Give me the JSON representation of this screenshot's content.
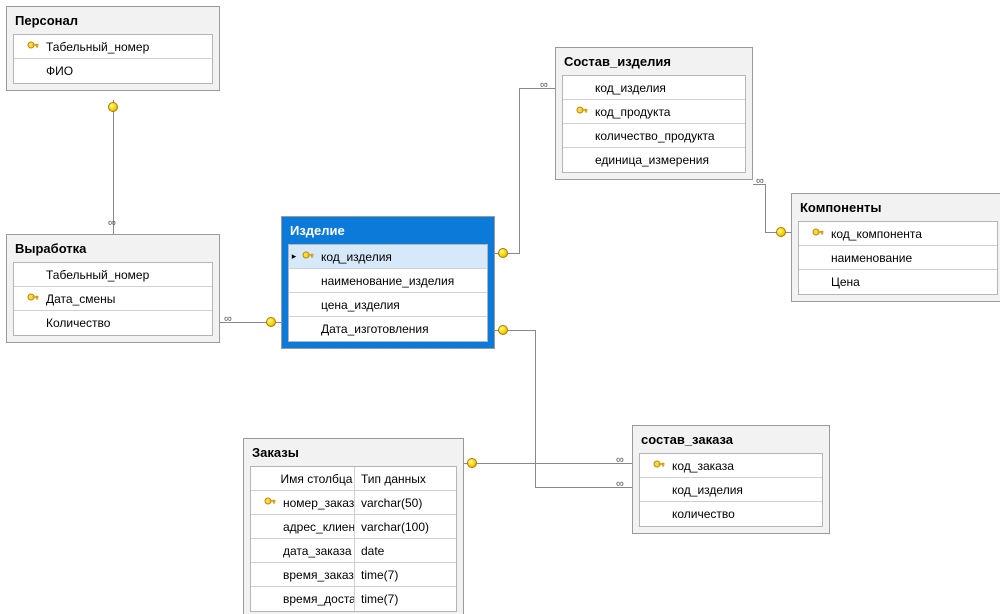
{
  "tables": {
    "personal": {
      "title": "Персонал",
      "fields": [
        {
          "key": true,
          "name": "Табельный_номер"
        },
        {
          "key": false,
          "name": "ФИО"
        }
      ]
    },
    "vyrabotka": {
      "title": "Выработка",
      "fields": [
        {
          "key": false,
          "name": "Табельный_номер"
        },
        {
          "key": true,
          "name": "Дата_смены"
        },
        {
          "key": false,
          "name": "Количество"
        }
      ]
    },
    "izdelie": {
      "title": "Изделие",
      "fields": [
        {
          "key": true,
          "name": "код_изделия",
          "selected": true
        },
        {
          "key": false,
          "name": "наименование_изделия"
        },
        {
          "key": false,
          "name": "цена_изделия"
        },
        {
          "key": false,
          "name": "Дата_изготовления"
        }
      ]
    },
    "sostav_izdeliya": {
      "title": "Состав_изделия",
      "fields": [
        {
          "key": false,
          "name": "код_изделия"
        },
        {
          "key": true,
          "name": "код_продукта"
        },
        {
          "key": false,
          "name": "количество_продукта"
        },
        {
          "key": false,
          "name": "единица_измерения"
        }
      ]
    },
    "komponenty": {
      "title": "Компоненты",
      "fields": [
        {
          "key": true,
          "name": "код_компонента"
        },
        {
          "key": false,
          "name": "наименование"
        },
        {
          "key": false,
          "name": "Цена"
        }
      ]
    },
    "zakazy": {
      "title": "Заказы",
      "header": {
        "col1": "Имя столбца",
        "col2": "Тип данных"
      },
      "fields": [
        {
          "key": true,
          "name": "номер_заказа",
          "type": "varchar(50)"
        },
        {
          "key": false,
          "name": "адрес_клиента",
          "type": "varchar(100)"
        },
        {
          "key": false,
          "name": "дата_заказа",
          "type": "date"
        },
        {
          "key": false,
          "name": "время_заказа",
          "type": "time(7)"
        },
        {
          "key": false,
          "name": "время_доставки",
          "type": "time(7)"
        }
      ]
    },
    "sostav_zakaza": {
      "title": "состав_заказа",
      "fields": [
        {
          "key": true,
          "name": "код_заказа"
        },
        {
          "key": false,
          "name": "код_изделия"
        },
        {
          "key": false,
          "name": "количество"
        }
      ]
    }
  },
  "glyphs": {
    "infinity": "∞",
    "selmarker": "▸"
  }
}
